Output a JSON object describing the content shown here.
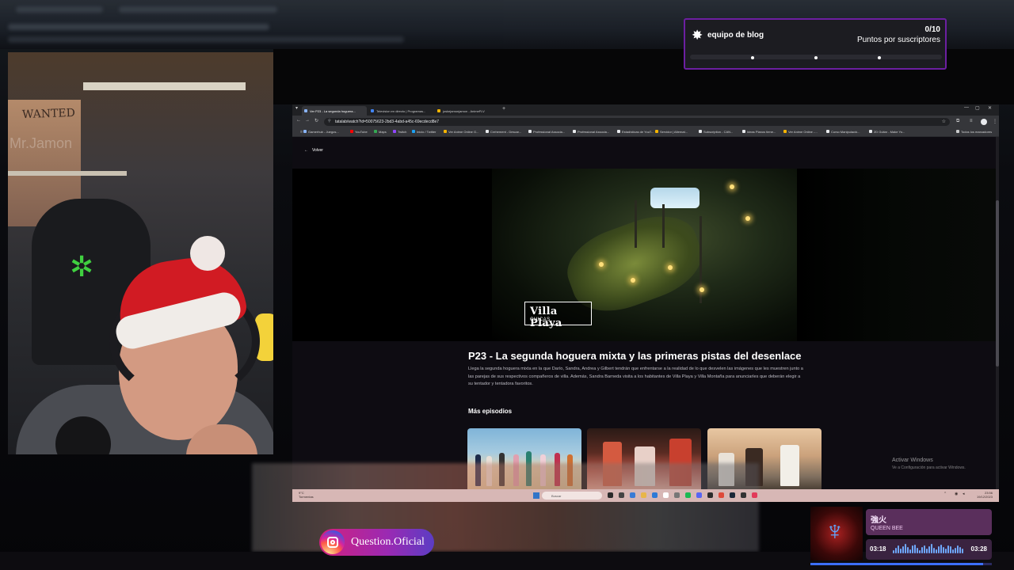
{
  "goal_widget": {
    "team_label": "equipo de blog",
    "count": "0/10",
    "subtitle": "Puntos por suscriptores",
    "progress": 0,
    "icon": "star-badge-icon"
  },
  "browser": {
    "tabs": [
      {
        "label": "Ver P23 - La segunda hoguera...",
        "active": true,
        "color": "#8ab4f8"
      },
      {
        "label": "Television en directo | Programas...",
        "active": false,
        "color": "#4285f4"
      },
      {
        "label": "joskejamonjamon - AnimeFLV",
        "active": false,
        "color": "#f5b400"
      }
    ],
    "url": "tatalab/watch?id=50075623-2bd3-4abd-a45c-69ecdecd8e7",
    "bookmarks": [
      {
        "label": "Gamerhub - Juegos...",
        "color": "#8ab4f8"
      },
      {
        "label": "YouTube",
        "color": "#ff0000"
      },
      {
        "label": "Maps",
        "color": "#34a853"
      },
      {
        "label": "Twitch",
        "color": "#9146ff"
      },
      {
        "label": "Inicio / Twitter",
        "color": "#1da1f2"
      },
      {
        "label": "Ver Anime Online G...",
        "color": "#f5b400"
      },
      {
        "label": "Crehement - Descar...",
        "color": "#e8eaed"
      },
      {
        "label": "Professional Associa...",
        "color": "#e8eaed"
      },
      {
        "label": "Professional Associa...",
        "color": "#e8eaed"
      },
      {
        "label": "Estadísticas de YouT...",
        "color": "#e8eaed"
      },
      {
        "label": "Servidor | Alternat...",
        "color": "#f5b400"
      },
      {
        "label": "Subscription - CAN...",
        "color": "#e8eaed"
      },
      {
        "label": "Ideas Pianos tiene...",
        "color": "#e8eaed"
      },
      {
        "label": "Ver Anime Online -...",
        "color": "#f5b400"
      },
      {
        "label": "Curso Manipulació...",
        "color": "#e8eaed"
      },
      {
        "label": "2D Guitar - Make Yo...",
        "color": "#e8eaed"
      }
    ],
    "all_bookmarks_label": "Todos los marcadores",
    "back_label": "Volver",
    "show_logo_line1": "Villa Playa",
    "show_logo_line2": "CHICAS",
    "episode_title": "P23 - La segunda hoguera mixta y las primeras pistas del desenlace",
    "episode_description": "Llega la segunda hoguera mixta en la que Darío, Sandra, Andrea y Gilbert tendrán que enfrentarse a la realidad de lo que desvelen las imágenes que les muestren junto a las parejas de sus respectivos compañeros de villa. Además, Sandra Barneda visita a los habitantes de Villa Playa y Villa Montaña para anunciarles que deberán elegir a su tentador y tentadora favoritos.",
    "more_episodes_label": "Más episodios"
  },
  "windows": {
    "activate_title": "Activar Windows",
    "activate_sub": "Ve a Configuración para activar Windows.",
    "weather": "9°C",
    "weather_desc": "Tormentas",
    "search_label": "Buscar",
    "time": "23:56",
    "date": "19/12/2023"
  },
  "instagram": {
    "handle": "Question.Oficial"
  },
  "music": {
    "song": "強火",
    "artist": "QUEEN BEE",
    "current": "03:18",
    "total": "03:28",
    "progress": 0.95
  }
}
